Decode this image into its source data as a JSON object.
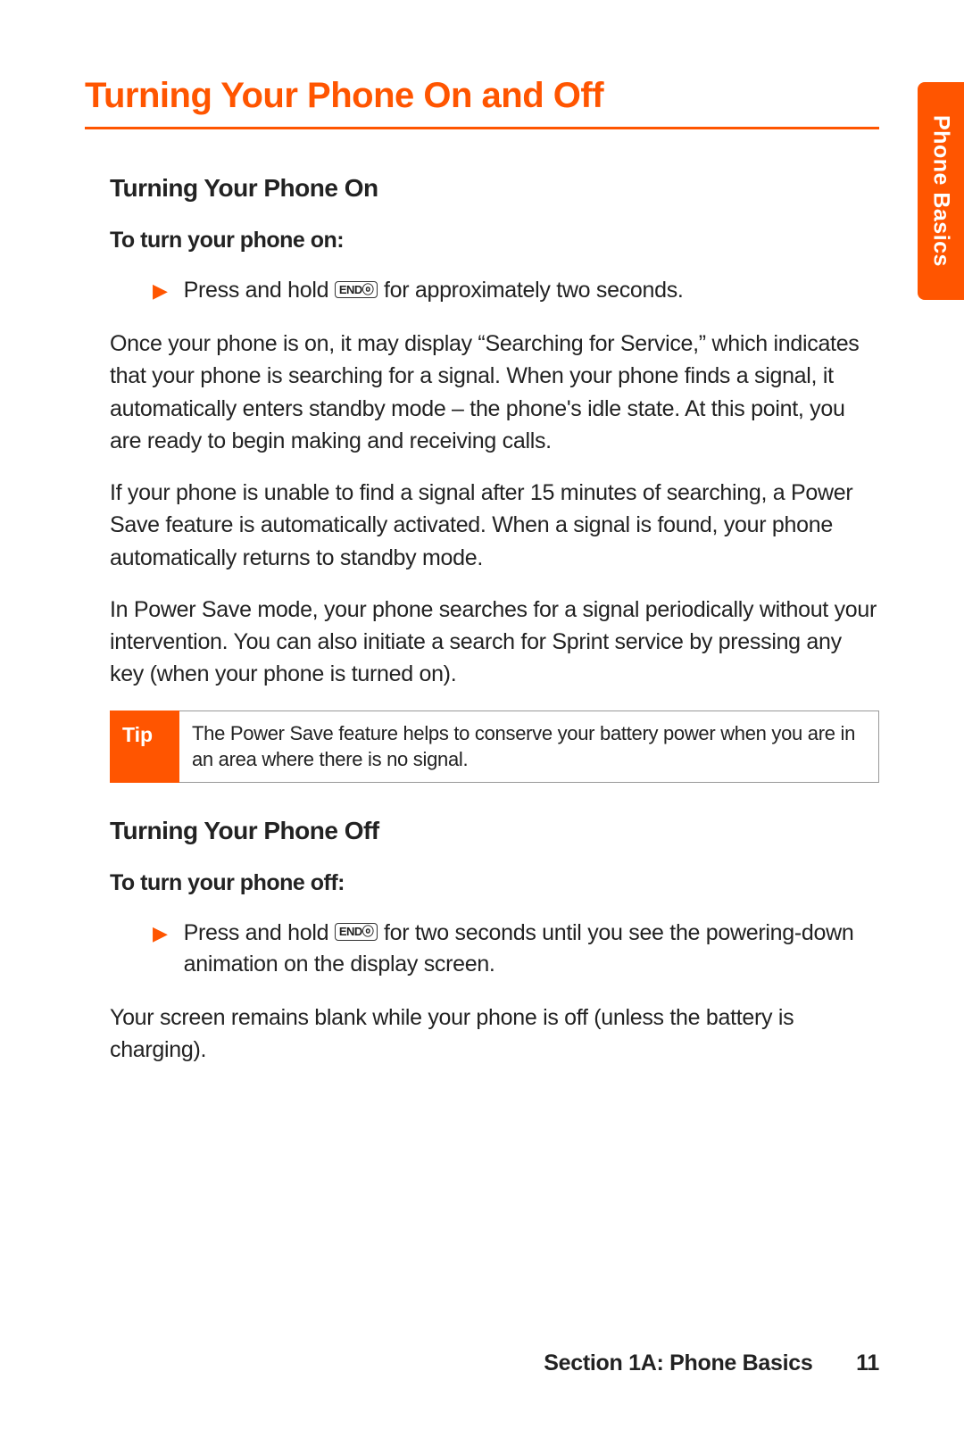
{
  "mainTitle": "Turning Your Phone On and Off",
  "sideTab": "Phone Basics",
  "section1": {
    "title": "Turning Your Phone On",
    "stepLabel": "To turn your phone on:",
    "bulletPre": "Press and hold ",
    "keyLabel": "ENDⓞ",
    "bulletPost": " for approximately two seconds.",
    "para1": "Once your phone is on, it may display “Searching for Service,” which indicates that your phone is searching for a signal. When your phone finds a signal, it automatically enters standby mode – the phone's idle state. At this point, you are ready to begin making and receiving calls.",
    "para2": "If your phone is unable to find a signal after 15 minutes of searching, a Power Save feature is automatically activated. When a signal is found, your phone automatically returns to standby mode.",
    "para3": "In Power Save mode, your phone searches for a signal periodically without your intervention. You can also initiate a search for Sprint service by pressing any key (when your phone is turned on)."
  },
  "tip": {
    "label": "Tip",
    "text": "The Power Save feature helps to conserve your battery power when you are in an area where there is no signal."
  },
  "section2": {
    "title": "Turning Your Phone Off",
    "stepLabel": "To turn your phone off:",
    "bulletPre": "Press and hold ",
    "keyLabel": "ENDⓞ",
    "bulletPost": " for two seconds until you see the powering-down animation on the display screen.",
    "para1": "Your screen remains blank while your phone is off (unless the battery is charging)."
  },
  "footer": {
    "section": "Section 1A: Phone Basics",
    "page": "11"
  }
}
